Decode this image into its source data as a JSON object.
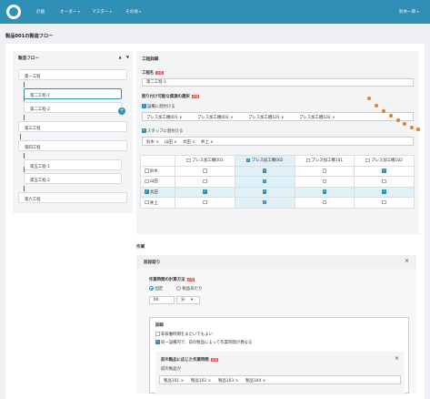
{
  "nav": {
    "items": [
      "計画",
      "オーダー",
      "マスター",
      "その他"
    ],
    "user": "鈴木一郎"
  },
  "page_title": "製品001の製造フロー",
  "flow": {
    "title": "製造フロー",
    "up": "▲",
    "down": "▼",
    "items": [
      {
        "label": "第一工程",
        "indent": false,
        "selected": false
      },
      {
        "label": "第二工程-1",
        "indent": true,
        "selected": true
      },
      {
        "label": "第二工程-2",
        "indent": true,
        "selected": false
      },
      {
        "label": "第三工程",
        "indent": false,
        "selected": false
      },
      {
        "label": "第四工程",
        "indent": false,
        "selected": false
      },
      {
        "label": "第五工程-1",
        "indent": true,
        "selected": false
      },
      {
        "label": "第五工程-2",
        "indent": true,
        "selected": false
      },
      {
        "label": "第六工程",
        "indent": false,
        "selected": false
      }
    ],
    "add": "+"
  },
  "detail": {
    "section_title": "工程詳細",
    "name_label": "工程名",
    "required": "必須",
    "name_value": "第二工程-1",
    "resource_label": "割り付け可能な資源の選択",
    "equipment_label": "設備に割付ける",
    "equipment_tags": [
      "プレス加工機001",
      "プレス加工機002",
      "プレス加工機101",
      "プレス加工機102"
    ],
    "staff_label": "スタッフに割付ける",
    "staff_tags": [
      "鈴木",
      "山田",
      "太田",
      "井上"
    ]
  },
  "grid": {
    "columns": [
      "プレス加工機001",
      "プレス加工機002",
      "プレス加工機101",
      "プレス加工機102"
    ],
    "col_checked": [
      false,
      true,
      false,
      false
    ],
    "rows": [
      {
        "name": "鈴木",
        "checked": false,
        "cells": [
          false,
          true,
          false,
          true
        ]
      },
      {
        "name": "山田",
        "checked": false,
        "cells": [
          false,
          true,
          false,
          false
        ]
      },
      {
        "name": "太田",
        "checked": true,
        "cells": [
          true,
          true,
          true,
          true
        ]
      },
      {
        "name": "井上",
        "checked": false,
        "cells": [
          false,
          true,
          false,
          false
        ]
      }
    ]
  },
  "work": {
    "title": "作業",
    "card_title": "前段取り",
    "close": "×",
    "method_label": "作業時間の計算方法",
    "required": "必須",
    "opt_fixed": "固定",
    "opt_per_product": "製品あたり",
    "time_value": "60",
    "unit_value": "分",
    "details_label": "詳細",
    "cb_nonworking": "非稼働時間をまたいでもよい",
    "cb_same_equipment": "同一設備内で、前の製品によって作業時間が異なる",
    "sub_title": "前の製品に応じた作業時間",
    "prev_label": "前の製品が",
    "product_tags": [
      "製品101",
      "製品102",
      "製品103",
      "製品104"
    ]
  },
  "colors": {
    "accent": "#2f8fb6",
    "required": "#e74c3c",
    "decoration": "#e67e22"
  }
}
